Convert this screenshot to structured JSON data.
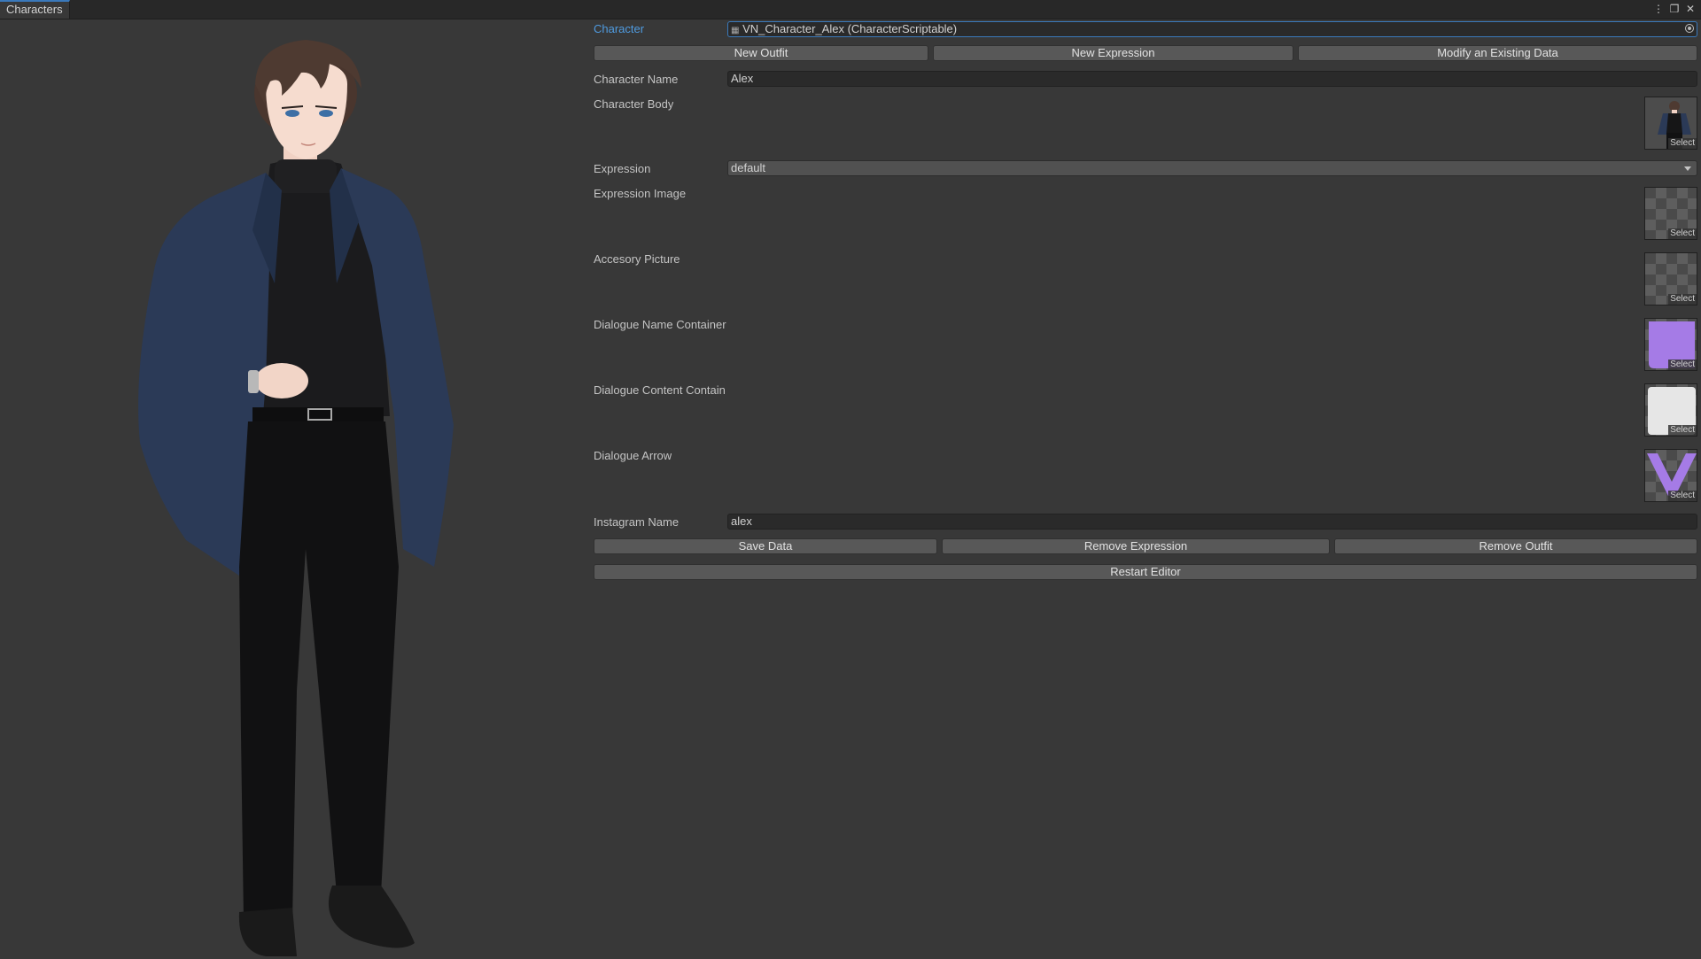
{
  "tab": {
    "title": "Characters"
  },
  "window_icons": [
    "more-options-icon",
    "maximize-icon",
    "close-icon"
  ],
  "character": {
    "label": "Character",
    "value": "VN_Character_Alex (CharacterScriptable)"
  },
  "top_buttons": {
    "new_outfit": "New Outfit",
    "new_expression": "New Expression",
    "modify_existing": "Modify an Existing Data"
  },
  "fields": {
    "character_name": {
      "label": "Character Name",
      "value": "Alex"
    },
    "character_body": {
      "label": "Character Body"
    },
    "expression": {
      "label": "Expression",
      "value": "default"
    },
    "expression_image": {
      "label": "Expression Image"
    },
    "accesory_picture": {
      "label": "Accesory Picture"
    },
    "dialogue_name_container": {
      "label": "Dialogue Name Container"
    },
    "dialogue_content_container": {
      "label": "Dialogue Content Containe"
    },
    "dialogue_arrow": {
      "label": "Dialogue Arrow"
    },
    "instagram_name": {
      "label": "Instagram Name",
      "value": "alex"
    }
  },
  "thumb_select_label": "Select",
  "colors": {
    "accent": "#3a79bb",
    "label_blue": "#4f9be0",
    "name_container": "#a57be6",
    "content_container": "#e6e6e6",
    "arrow": "#a57be6"
  },
  "bottom_buttons": {
    "save_data": "Save Data",
    "remove_expression": "Remove Expression",
    "remove_outfit": "Remove Outfit",
    "restart_editor": "Restart Editor"
  }
}
